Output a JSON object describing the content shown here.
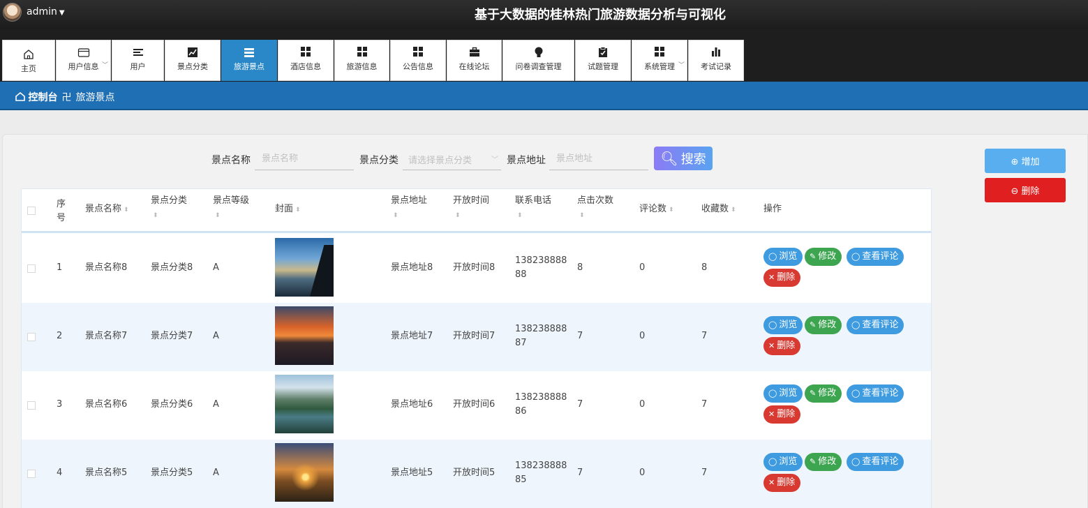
{
  "header": {
    "user": "admin",
    "title": "基于大数据的桂林热门旅游数据分析与可视化"
  },
  "nav": [
    {
      "label": "主页",
      "icon": "home-icon"
    },
    {
      "label": "用户信息",
      "icon": "card-icon",
      "dropdown": true
    },
    {
      "label": "用户",
      "icon": "list-icon"
    },
    {
      "label": "景点分类",
      "icon": "chart-line-icon"
    },
    {
      "label": "旅游景点",
      "icon": "stack-icon",
      "active": true
    },
    {
      "label": "酒店信息",
      "icon": "grid-icon"
    },
    {
      "label": "旅游信息",
      "icon": "grid-icon"
    },
    {
      "label": "公告信息",
      "icon": "grid-icon"
    },
    {
      "label": "在线论坛",
      "icon": "briefcase-icon"
    },
    {
      "label": "问卷调查管理",
      "icon": "bulb-icon"
    },
    {
      "label": "试题管理",
      "icon": "clipboard-icon"
    },
    {
      "label": "系统管理",
      "icon": "grid-icon",
      "dropdown": true
    },
    {
      "label": "考试记录",
      "icon": "bar-chart-icon"
    }
  ],
  "breadcrumb": {
    "home": "控制台",
    "separator": "卍",
    "current": "旅游景点"
  },
  "search": {
    "name_label": "景点名称",
    "name_placeholder": "景点名称",
    "category_label": "景点分类",
    "category_placeholder": "请选择景点分类",
    "address_label": "景点地址",
    "address_placeholder": "景点地址",
    "button": "搜索"
  },
  "actions": {
    "add": "增加",
    "delete": "删除"
  },
  "table": {
    "columns": {
      "index": "序号",
      "name": "景点名称",
      "category": "景点分类",
      "level": "景点等级",
      "cover": "封面",
      "address": "景点地址",
      "open_time": "开放时间",
      "phone": "联系电话",
      "clicks": "点击次数",
      "comments": "评论数",
      "favorites": "收藏数",
      "ops": "操作"
    },
    "rows": [
      {
        "index": "1",
        "name": "景点名称8",
        "category": "景点分类8",
        "level": "A",
        "address": "景点地址8",
        "open_time": "开放时间8",
        "phone_line1": "138238888",
        "phone_line2": "88",
        "clicks": "8",
        "comments": "0",
        "favorites": "8"
      },
      {
        "index": "2",
        "name": "景点名称7",
        "category": "景点分类7",
        "level": "A",
        "address": "景点地址7",
        "open_time": "开放时间7",
        "phone_line1": "138238888",
        "phone_line2": "87",
        "clicks": "7",
        "comments": "0",
        "favorites": "7"
      },
      {
        "index": "3",
        "name": "景点名称6",
        "category": "景点分类6",
        "level": "A",
        "address": "景点地址6",
        "open_time": "开放时间6",
        "phone_line1": "138238888",
        "phone_line2": "86",
        "clicks": "7",
        "comments": "0",
        "favorites": "7"
      },
      {
        "index": "4",
        "name": "景点名称5",
        "category": "景点分类5",
        "level": "A",
        "address": "景点地址5",
        "open_time": "开放时间5",
        "phone_line1": "138238888",
        "phone_line2": "85",
        "clicks": "7",
        "comments": "0",
        "favorites": "7"
      }
    ],
    "row_ops": {
      "view": "浏览",
      "edit": "修改",
      "comments": "查看评论",
      "delete": "删除"
    }
  }
}
